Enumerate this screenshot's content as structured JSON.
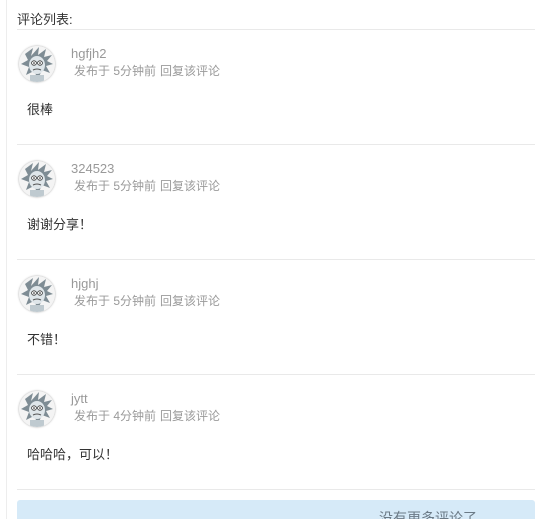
{
  "comments_section": {
    "title": "评论列表:",
    "reply_label": "回复该评论",
    "load_more_label": "没有更多评论了"
  },
  "comments": [
    {
      "username": "hgfjh2",
      "time": "发布于 5分钟前",
      "content": "很棒"
    },
    {
      "username": "324523",
      "time": "发布于 5分钟前",
      "content": "谢谢分享！"
    },
    {
      "username": "hjghj",
      "time": "发布于 5分钟前",
      "content": "不错！"
    },
    {
      "username": "jytt",
      "time": "发布于 4分钟前",
      "content": "哈哈哈，可以！"
    }
  ],
  "icons": {
    "avatar": "user-avatar-icon"
  },
  "colors": {
    "load_more_bg": "#d6eaf8",
    "meta_text": "#9a9a9a",
    "divider": "#e9e9e9"
  }
}
